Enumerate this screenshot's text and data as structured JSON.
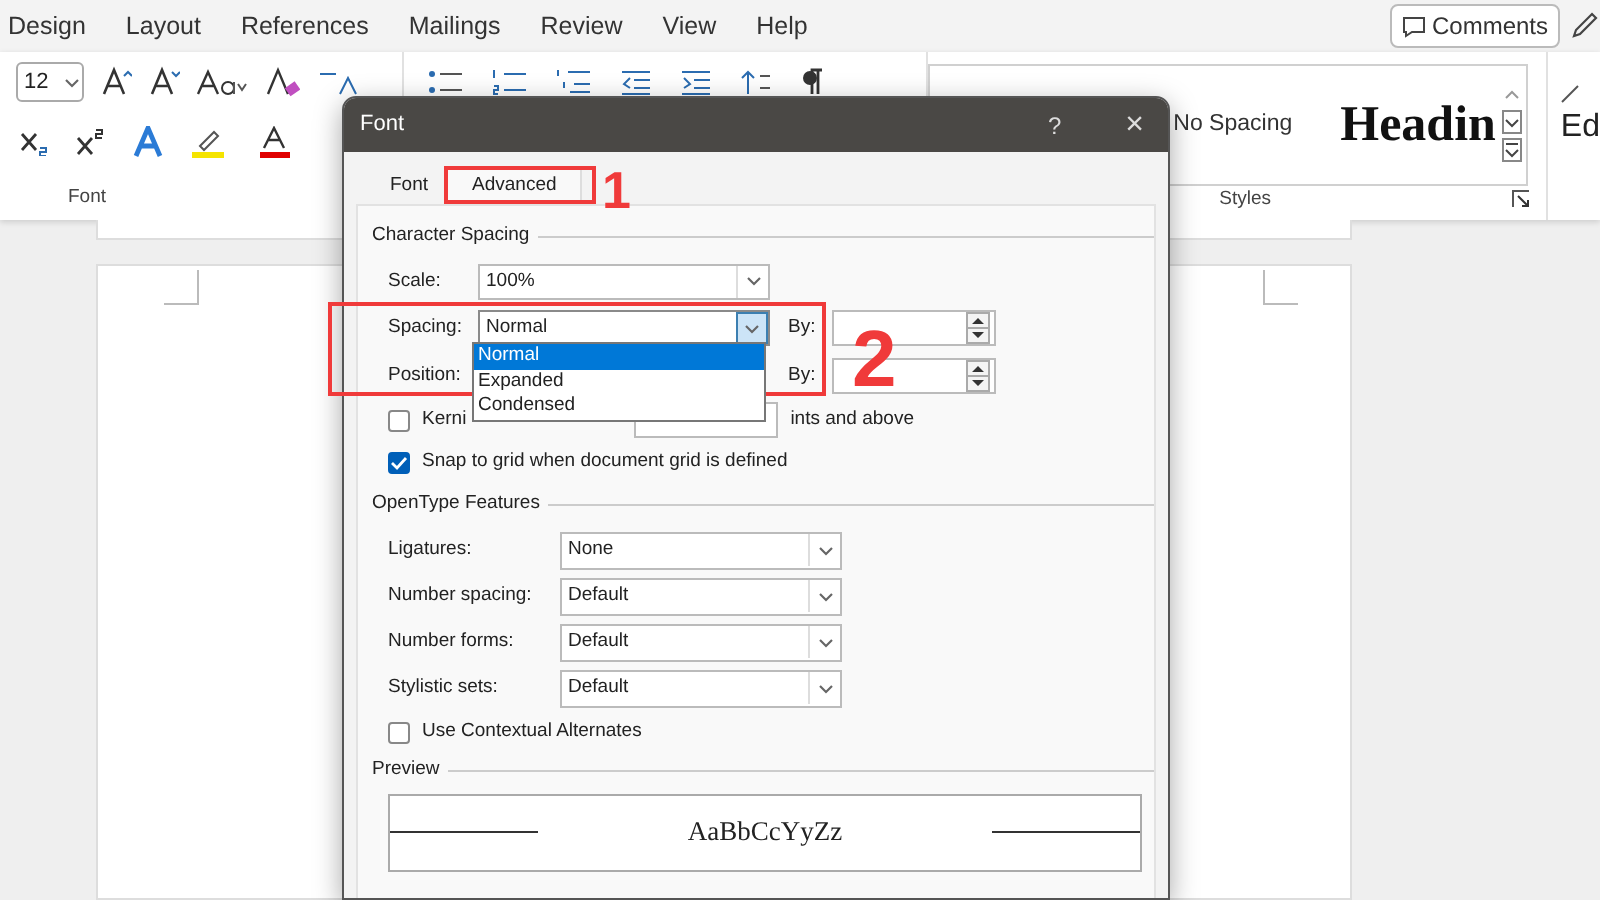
{
  "menu_bar": {
    "items": [
      "Design",
      "Layout",
      "References",
      "Mailings",
      "Review",
      "View",
      "Help"
    ],
    "comments_button": "Comments"
  },
  "ribbon": {
    "font_size": "12",
    "styles": [
      {
        "label": "No Spacing",
        "kind": "plain"
      },
      {
        "label": "Headin",
        "kind": "heading"
      }
    ],
    "group_labels": [
      "Font",
      "Styles"
    ],
    "editing_label": "Ed"
  },
  "dialog": {
    "title": "Font",
    "help": "?",
    "close": "×",
    "tabs": [
      {
        "label": "Font",
        "selected": false
      },
      {
        "label": "Advanced",
        "selected": true
      }
    ],
    "character_spacing": {
      "title": "Character Spacing",
      "rows": [
        {
          "label": "Scale:",
          "value": "100%",
          "kind": "combo",
          "focused": false
        },
        {
          "label": "Spacing:",
          "value": "Normal",
          "kind": "combo_by",
          "by": "By:",
          "focused": true
        },
        {
          "label": "Position:",
          "kind": "by_only",
          "by": "By:"
        }
      ],
      "dropdown": [
        {
          "label": "Normal",
          "selected": true
        },
        {
          "label": "Expanded",
          "selected": false
        },
        {
          "label": "Condensed",
          "selected": false
        }
      ],
      "kerning": {
        "label": "Kerni",
        "suffix": "ints and above",
        "checked": false
      },
      "snap": {
        "label": "Snap to grid when document grid is defined",
        "checked": true
      }
    },
    "opentype": {
      "title": "OpenType Features",
      "rows": [
        {
          "label": "Ligatures:",
          "value": "None"
        },
        {
          "label": "Number spacing:",
          "value": "Default"
        },
        {
          "label": "Number forms:",
          "value": "Default"
        },
        {
          "label": "Stylistic sets:",
          "value": "Default"
        }
      ],
      "contextual": {
        "label": "Use Contextual Alternates",
        "checked": false
      }
    },
    "preview": {
      "title": "Preview",
      "sample": "AaBbCcYyZz"
    }
  },
  "annotations": [
    {
      "label": "1"
    },
    {
      "label": "2"
    }
  ]
}
